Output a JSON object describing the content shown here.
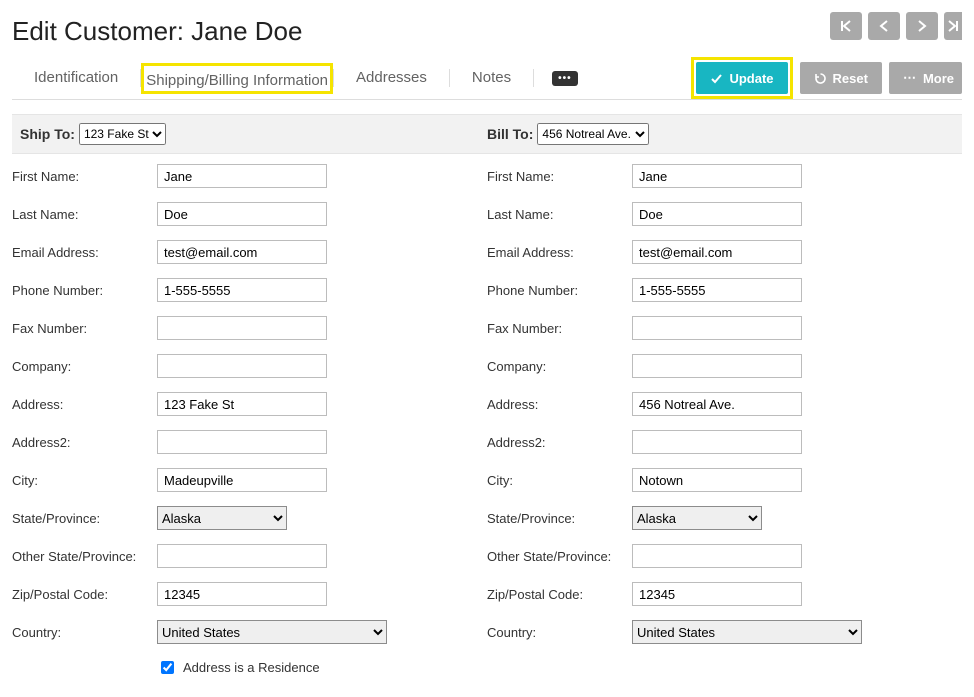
{
  "page": {
    "title": "Edit Customer: Jane Doe"
  },
  "tabs": {
    "identification": "Identification",
    "shipping_billing": "Shipping/Billing Information",
    "addresses": "Addresses",
    "notes": "Notes"
  },
  "actions": {
    "update": "Update",
    "reset": "Reset",
    "more": "More"
  },
  "section": {
    "ship_to_label": "Ship To:",
    "ship_to_value": "123 Fake St",
    "bill_to_label": "Bill To:",
    "bill_to_value": "456 Notreal Ave."
  },
  "labels": {
    "first_name": "First Name:",
    "last_name": "Last Name:",
    "email": "Email Address:",
    "phone": "Phone Number:",
    "fax": "Fax Number:",
    "company": "Company:",
    "address": "Address:",
    "address2": "Address2:",
    "city": "City:",
    "state": "State/Province:",
    "other_state": "Other State/Province:",
    "zip": "Zip/Postal Code:",
    "country": "Country:",
    "residence": "Address is a Residence"
  },
  "ship": {
    "first_name": "Jane",
    "last_name": "Doe",
    "email": "test@email.com",
    "phone": "1-555-5555",
    "fax": "",
    "company": "",
    "address": "123 Fake St",
    "address2": "",
    "city": "Madeupville",
    "state": "Alaska",
    "other_state": "",
    "zip": "12345",
    "country": "United States",
    "residence_checked": true
  },
  "bill": {
    "first_name": "Jane",
    "last_name": "Doe",
    "email": "test@email.com",
    "phone": "1-555-5555",
    "fax": "",
    "company": "",
    "address": "456 Notreal Ave.",
    "address2": "",
    "city": "Notown",
    "state": "Alaska",
    "other_state": "",
    "zip": "12345",
    "country": "United States"
  }
}
